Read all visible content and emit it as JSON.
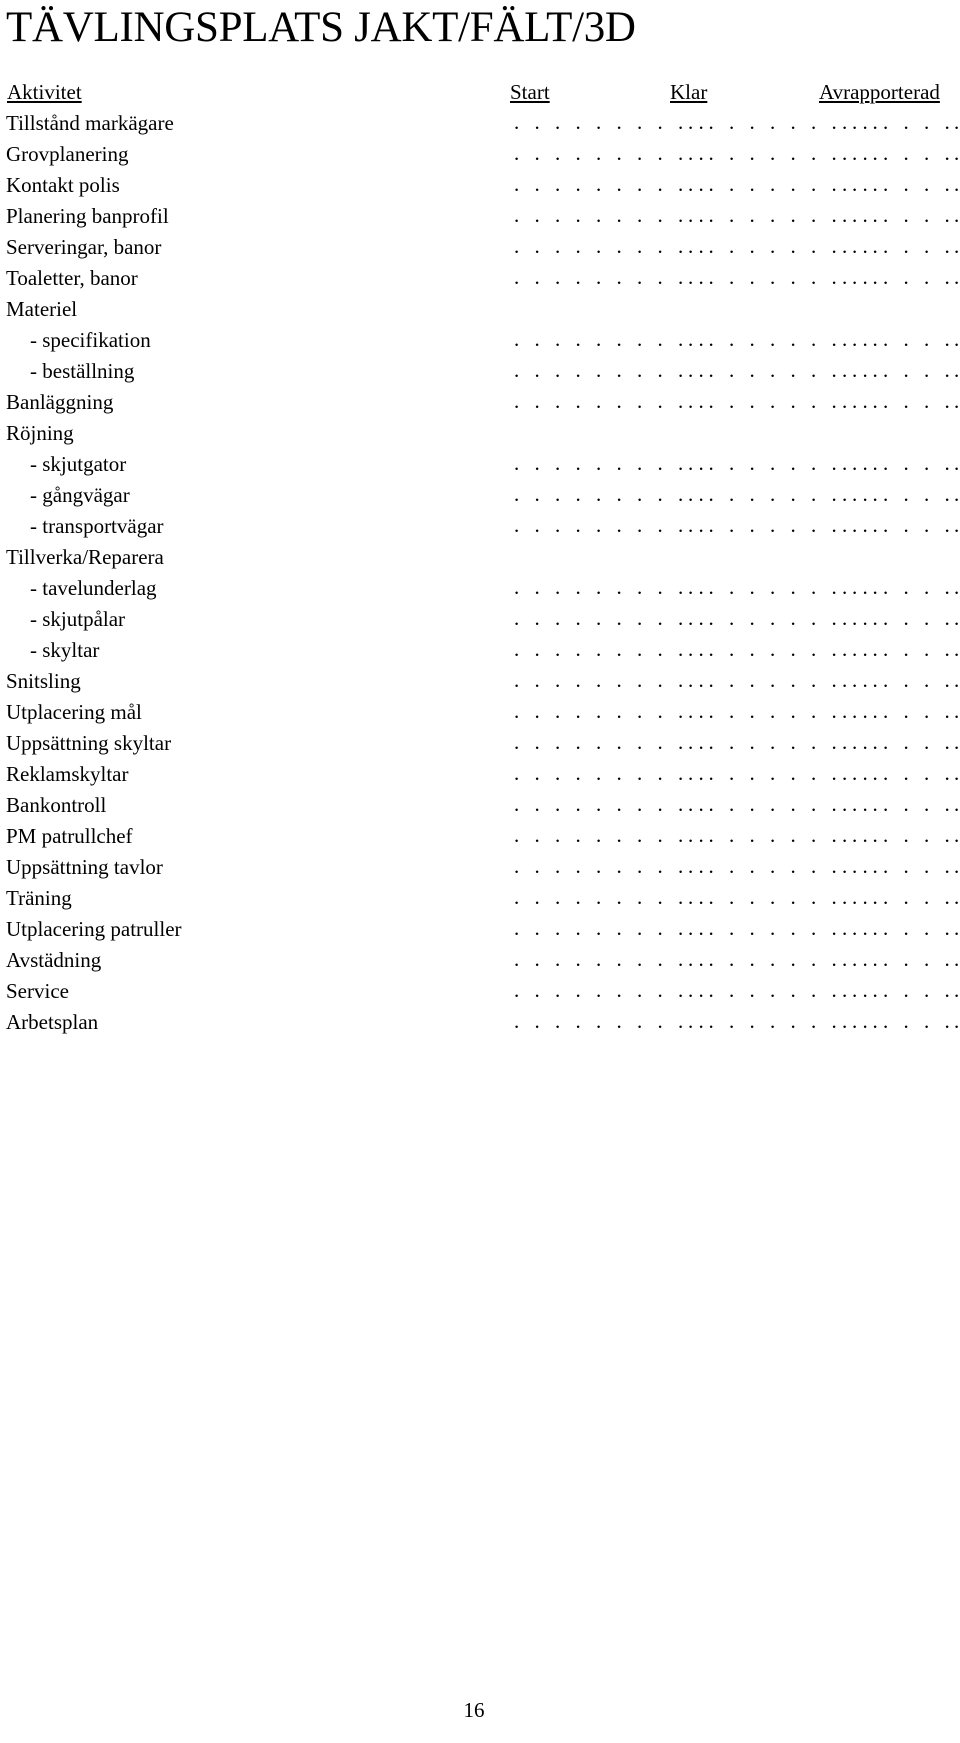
{
  "document": {
    "title": "TÄVLINGSPLATS JAKT/FÄLT/3D",
    "page_number": "16",
    "dot_leader": ". . . . . . . . . ."
  },
  "table": {
    "columns": [
      {
        "key": "activity",
        "label": "Aktivitet"
      },
      {
        "key": "start",
        "label": "Start"
      },
      {
        "key": "klar",
        "label": "Klar"
      },
      {
        "key": "avrapporterad",
        "label": "Avrapporterad"
      },
      {
        "key": "extra",
        "label": ""
      }
    ],
    "rows": [
      {
        "label": "Tillstånd markägare",
        "indent": false,
        "has_dots": true
      },
      {
        "label": "Grovplanering",
        "indent": false,
        "has_dots": true
      },
      {
        "label": "Kontakt polis",
        "indent": false,
        "has_dots": true
      },
      {
        "label": "Planering banprofil",
        "indent": false,
        "has_dots": true
      },
      {
        "label": "Serveringar, banor",
        "indent": false,
        "has_dots": true
      },
      {
        "label": "Toaletter, banor",
        "indent": false,
        "has_dots": true
      },
      {
        "label": "Materiel",
        "indent": false,
        "has_dots": false
      },
      {
        "label": "- specifikation",
        "indent": true,
        "has_dots": true
      },
      {
        "label": "- beställning",
        "indent": true,
        "has_dots": true
      },
      {
        "label": "Banläggning",
        "indent": false,
        "has_dots": true
      },
      {
        "label": "Röjning",
        "indent": false,
        "has_dots": false
      },
      {
        "label": "- skjutgator",
        "indent": true,
        "has_dots": true
      },
      {
        "label": "- gångvägar",
        "indent": true,
        "has_dots": true
      },
      {
        "label": "- transportvägar",
        "indent": true,
        "has_dots": true
      },
      {
        "label": "Tillverka/Reparera",
        "indent": false,
        "has_dots": false
      },
      {
        "label": "- tavelunderlag",
        "indent": true,
        "has_dots": true
      },
      {
        "label": "- skjutpålar",
        "indent": true,
        "has_dots": true
      },
      {
        "label": "- skyltar",
        "indent": true,
        "has_dots": true
      },
      {
        "label": "Snitsling",
        "indent": false,
        "has_dots": true
      },
      {
        "label": "Utplacering mål",
        "indent": false,
        "has_dots": true
      },
      {
        "label": "Uppsättning skyltar",
        "indent": false,
        "has_dots": true
      },
      {
        "label": "Reklamskyltar",
        "indent": false,
        "has_dots": true
      },
      {
        "label": "Bankontroll",
        "indent": false,
        "has_dots": true
      },
      {
        "label": "PM patrullchef",
        "indent": false,
        "has_dots": true
      },
      {
        "label": "Uppsättning tavlor",
        "indent": false,
        "has_dots": true
      },
      {
        "label": "Träning",
        "indent": false,
        "has_dots": true
      },
      {
        "label": "Utplacering patruller",
        "indent": false,
        "has_dots": true
      },
      {
        "label": "Avstädning",
        "indent": false,
        "has_dots": true
      },
      {
        "label": "Service",
        "indent": false,
        "has_dots": true
      },
      {
        "label": "Arbetsplan",
        "indent": false,
        "has_dots": true
      }
    ]
  }
}
